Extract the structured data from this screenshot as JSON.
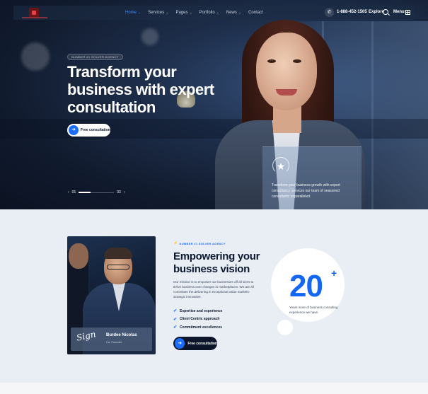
{
  "nav": {
    "items": [
      {
        "label": "Home",
        "active": true
      },
      {
        "label": "Services",
        "active": false
      },
      {
        "label": "Pages",
        "active": false
      },
      {
        "label": "Portfolio",
        "active": false
      },
      {
        "label": "News",
        "active": false
      },
      {
        "label": "Contact",
        "active": false
      }
    ],
    "chevron": "⌄",
    "phone": "1-888-452-1505",
    "explore": "Explore",
    "menu": "Menu"
  },
  "hero": {
    "badge": "NUMBER #1 SOLVER AGENCY",
    "title": "Transform your business with expert consultation",
    "cta_label": "Free consultation",
    "slider_current": "01",
    "slider_total": "03",
    "slider_progress": 0.33,
    "card_text": "Transform your business growth with expert consultancy services our team of seasoned consultants unparalleled."
  },
  "about": {
    "tag": "NUMBER #1 SOLVER AGENCY",
    "title": "Empowering your business vision",
    "description": "Our mission is to empower our businesses off all sizes to thrive business ever changes in marketplaces. We are all committee the delivering in exceptional value markets- strategic innovative.",
    "checks": [
      "Expertise and experience",
      "Client Centric approach",
      "Commitment excellences"
    ],
    "cta_label": "Free consultation",
    "signature": "Sign",
    "person_name": "Burdee Nicolas",
    "person_role": "Ca. Founder",
    "stat_number": "20",
    "stat_plus": "+",
    "stat_text": "Years more of business consulting experience we have."
  },
  "colors": {
    "accent": "#1a6dff",
    "dark": "#0b1428",
    "hero_bg": "#111b2e"
  },
  "icons": {
    "phone": "phone-icon",
    "search": "search-icon",
    "grid": "grid-icon",
    "arrow": "arrow-right-icon",
    "check": "check-icon",
    "award": "award-icon",
    "bolt": "bolt-icon"
  }
}
